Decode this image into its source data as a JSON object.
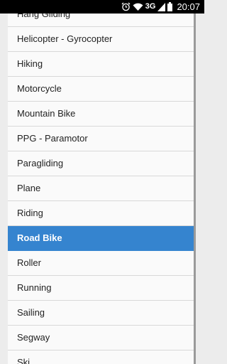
{
  "status_bar": {
    "network": "3G",
    "time": "20:07"
  },
  "activities": {
    "selected": "Road Bike",
    "items": [
      "Hang Gliding",
      "Helicopter - Gyrocopter",
      "Hiking",
      "Motorcycle",
      "Mountain Bike",
      "PPG - Paramotor",
      "Paragliding",
      "Plane",
      "Riding",
      "Road Bike",
      "Roller",
      "Running",
      "Sailing",
      "Segway",
      "Ski"
    ]
  }
}
